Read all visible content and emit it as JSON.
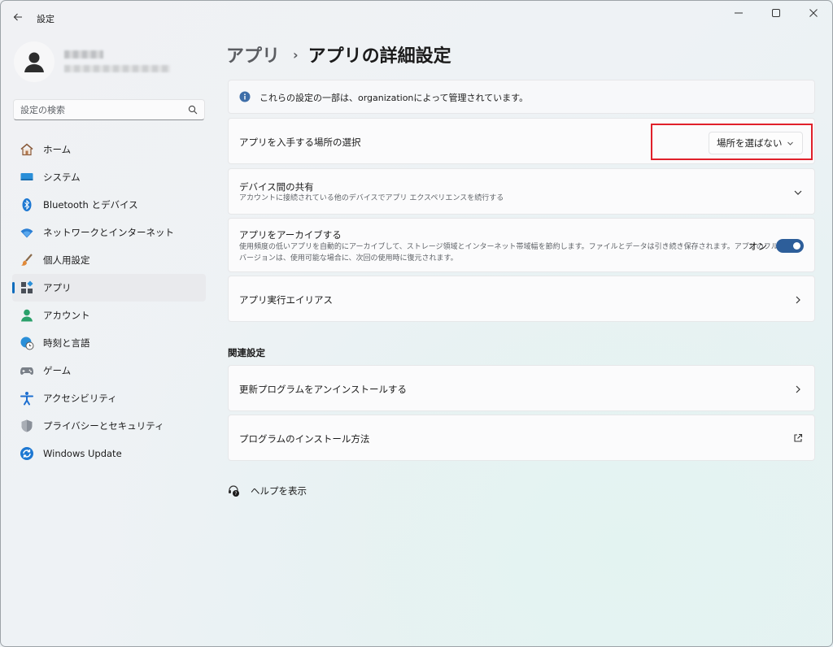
{
  "window": {
    "title": "設定"
  },
  "search": {
    "placeholder": "設定の検索"
  },
  "nav": {
    "items": [
      {
        "label": "ホーム",
        "icon": "home-icon"
      },
      {
        "label": "システム",
        "icon": "system-icon"
      },
      {
        "label": "Bluetooth とデバイス",
        "icon": "bluetooth-icon"
      },
      {
        "label": "ネットワークとインターネット",
        "icon": "wifi-icon"
      },
      {
        "label": "個人用設定",
        "icon": "brush-icon"
      },
      {
        "label": "アプリ",
        "icon": "apps-icon",
        "selected": true
      },
      {
        "label": "アカウント",
        "icon": "account-icon"
      },
      {
        "label": "時刻と言語",
        "icon": "globe-clock-icon"
      },
      {
        "label": "ゲーム",
        "icon": "gamepad-icon"
      },
      {
        "label": "アクセシビリティ",
        "icon": "accessibility-icon"
      },
      {
        "label": "プライバシーとセキュリティ",
        "icon": "shield-icon"
      },
      {
        "label": "Windows Update",
        "icon": "update-icon"
      }
    ]
  },
  "breadcrumb": {
    "parent": "アプリ",
    "separator": "›",
    "current": "アプリの詳細設定"
  },
  "info_banner": {
    "text": "これらの設定の一部は、organizationによって管理されています。"
  },
  "app_source": {
    "title": "アプリを入手する場所の選択",
    "selected": "場所を選ばない"
  },
  "device_share": {
    "title": "デバイス間の共有",
    "subtitle": "アカウントに接続されている他のデバイスでアプリ エクスペリエンスを続行する"
  },
  "archive": {
    "title": "アプリをアーカイブする",
    "subtitle_line1": "使用頻度の低いアプリを自動的にアーカイブして、ストレージ領域とインターネット帯域幅を節約します。ファイルとデータは引き続き保存されます。アプリのフル",
    "subtitle_line2": "バージョンは、使用可能な場合に、次回の使用時に復元されます。",
    "state_label": "オン",
    "on": true
  },
  "execution_alias": {
    "title": "アプリ実行エイリアス"
  },
  "related": {
    "heading": "関連設定",
    "items": [
      {
        "title": "更新プログラムをアンインストールする"
      },
      {
        "title": "プログラムのインストール方法"
      }
    ]
  },
  "help": {
    "label": "ヘルプを表示"
  },
  "colors": {
    "accent": "#0f6cbd",
    "toggle": "#2d5e9a",
    "highlight": "#e0202a"
  }
}
